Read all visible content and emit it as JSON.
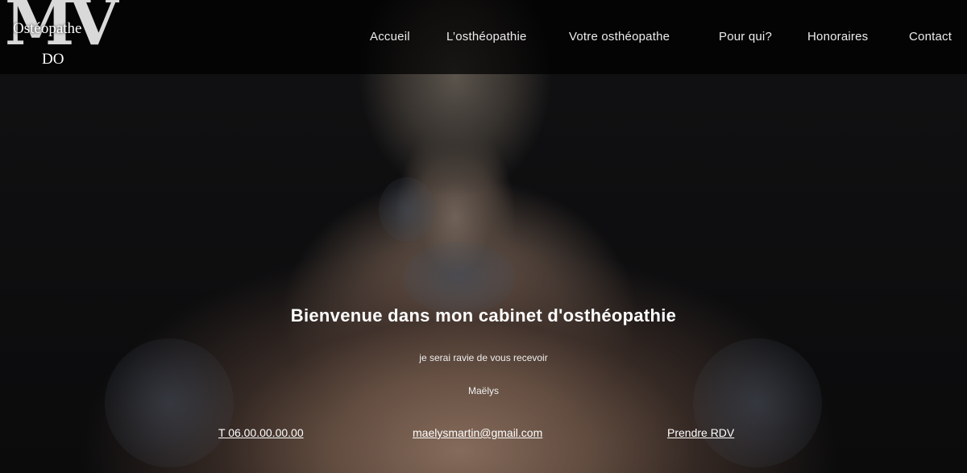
{
  "logo": {
    "mark": "MV",
    "line1": "Ostéopathe",
    "line2": "DO"
  },
  "nav": {
    "items": [
      {
        "label": "Accueil"
      },
      {
        "label": "L’osthéopathie"
      },
      {
        "label": "Votre osthéopathe"
      },
      {
        "label": "Pour qui?"
      },
      {
        "label": "Honoraires"
      },
      {
        "label": "Contact"
      }
    ]
  },
  "hero": {
    "headline": "Bienvenue dans mon cabinet d'osthéopathie",
    "subline": "je serai ravie de vous recevoir",
    "signature": "Maëlys"
  },
  "contact": {
    "phone": "T 06.00.00.00.00",
    "email": "maelysmartin@gmail.com",
    "appointment": "Prendre RDV"
  }
}
